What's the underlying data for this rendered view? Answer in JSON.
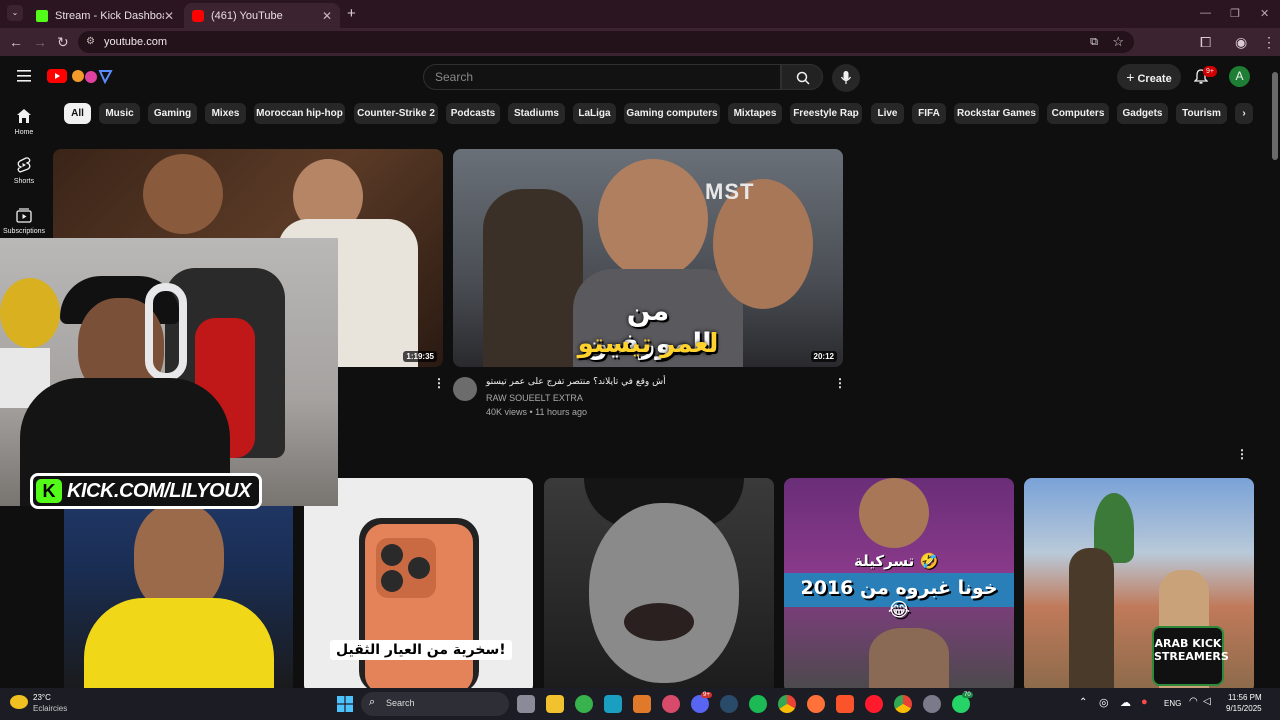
{
  "browser": {
    "tabs": [
      {
        "title": "Stream - Kick Dashboard",
        "favicon_color": "#53fc18"
      },
      {
        "title": "(461) YouTube",
        "favicon_color": "#ff0000"
      }
    ],
    "url": "youtube.com"
  },
  "youtube": {
    "search_placeholder": "Search",
    "create_label": "Create",
    "notification_count": "9+",
    "avatar_letter": "A",
    "sidebar": [
      {
        "label": "Home",
        "icon": "home-icon"
      },
      {
        "label": "Shorts",
        "icon": "shorts-icon"
      },
      {
        "label": "Subscriptions",
        "icon": "subscriptions-icon"
      }
    ],
    "chips": [
      "All",
      "Music",
      "Gaming",
      "Mixes",
      "Moroccan hip-hop",
      "Counter-Strike 2",
      "Podcasts",
      "Stadiums",
      "LaLiga",
      "Gaming computers",
      "Mixtapes",
      "Freestyle Rap",
      "Live",
      "FIFA",
      "Rockstar Games",
      "Computers",
      "Gadgets",
      "Tourism"
    ],
    "videos": [
      {
        "duration": "1:19:35"
      },
      {
        "duration": "20:12",
        "thumb_text_line1": "من المورفين",
        "thumb_text_line2": "لعمر تيستو",
        "thumb_badge": "MST",
        "title": "أش وقع في تايلاند؟ منتصر تفرج على عمر تيستو",
        "channel": "RAW SOUEELT EXTRA",
        "stats": "40K views • 11 hours ago"
      }
    ],
    "shorts_captions": {
      "phone": "سخرية من العيار الثقيل!",
      "caption_top": "تسركيلة 🤣",
      "caption_bottom": "خونا غبروه من 2016 😂"
    },
    "watermark": "ARAB KICK STREAMERS"
  },
  "overlay": {
    "kick_url": "KICK.COM/LILYOUX"
  },
  "taskbar": {
    "weather_temp": "23°C",
    "weather_desc": "Eclaircies",
    "search_label": "Search",
    "language": "ENG",
    "time": "11:56 PM",
    "date": "9/15/2025",
    "badges": {
      "discord": "9+",
      "whatsapp": "70"
    }
  }
}
